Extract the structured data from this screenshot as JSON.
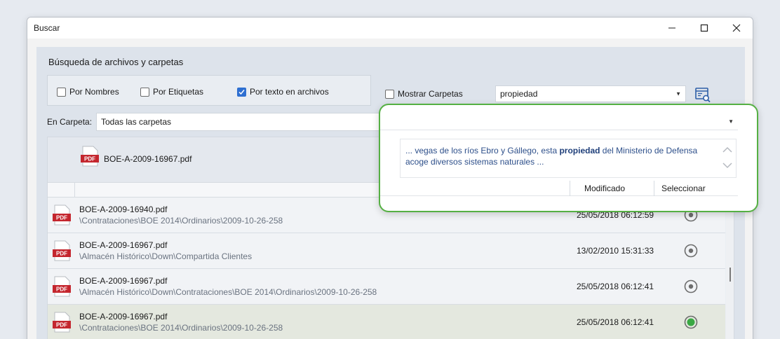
{
  "window": {
    "title": "Buscar"
  },
  "section_title": "Búsqueda de archivos y carpetas",
  "filters": [
    {
      "label": "Por Nombres",
      "checked": false
    },
    {
      "label": "Por Etiquetas",
      "checked": false
    },
    {
      "label": "Por texto en archivos",
      "checked": true
    }
  ],
  "show_folders": {
    "label": "Mostrar Carpetas",
    "checked": false
  },
  "search": {
    "value": "propiedad"
  },
  "folder": {
    "label": "En Carpeta:",
    "value": "Todas las carpetas"
  },
  "preview": {
    "file": "BOE-A-2009-16967.pdf",
    "snippet_pre": "... vegas de los ríos Ebro y Gállego, esta ",
    "snippet_hl": "propiedad",
    "snippet_post": " del Ministerio de Defensa acoge diversos sistemas naturales ..."
  },
  "columns": {
    "modified": "Modificado",
    "select": "Seleccionar"
  },
  "rows": [
    {
      "name": "BOE-A-2009-16940.pdf",
      "path": "\\Contrataciones\\BOE 2014\\Ordinarios\\2009-10-26-258",
      "date": "25/05/2018 06:12:59",
      "selected": false
    },
    {
      "name": "BOE-A-2009-16967.pdf",
      "path": "\\Almacén Histórico\\Down\\Compartida Clientes",
      "date": "13/02/2010 15:31:33",
      "selected": false
    },
    {
      "name": "BOE-A-2009-16967.pdf",
      "path": "\\Almacén Histórico\\Down\\Contrataciones\\BOE 2014\\Ordinarios\\2009-10-26-258",
      "date": "25/05/2018 06:12:41",
      "selected": false
    },
    {
      "name": "BOE-A-2009-16967.pdf",
      "path": "\\Contrataciones\\BOE 2014\\Ordinarios\\2009-10-26-258",
      "date": "25/05/2018 06:12:41",
      "selected": true
    }
  ],
  "icons": {
    "pdf_label": "PDF"
  },
  "colors": {
    "accent": "#2e6fd1",
    "highlight_border": "#55b043",
    "pdf_red": "#c4262e",
    "selected_radio": "#3aa844"
  }
}
